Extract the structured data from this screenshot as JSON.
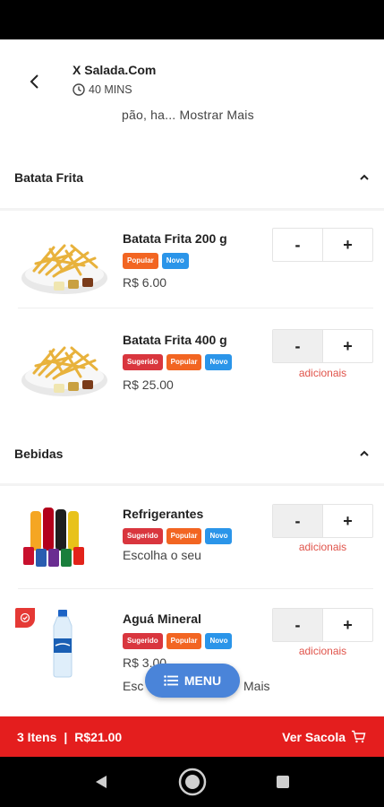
{
  "header": {
    "store_name": "X Salada.Com",
    "eta": "40 MINS",
    "description_tail": "pão,   ha... Mostrar Mais"
  },
  "sections": [
    {
      "title": "Batata Frita",
      "products": [
        {
          "name": "Batata Frita 200 g",
          "tags": [
            "Popular",
            "Novo"
          ],
          "price": "R$ 6.00"
        },
        {
          "name": "Batata Frita 400 g",
          "tags": [
            "Sugerido",
            "Popular",
            "Novo"
          ],
          "price": "R$ 25.00",
          "addons": "adicionais"
        }
      ]
    },
    {
      "title": "Bebidas",
      "products": [
        {
          "name": "Refrigerantes",
          "tags": [
            "Sugerido",
            "Popular",
            "Novo"
          ],
          "subtitle": "Escolha o seu",
          "addons": "adicionais"
        },
        {
          "name": "Aguá Mineral",
          "tags": [
            "Sugerido",
            "Popular",
            "Novo"
          ],
          "price": "R$ 3.00",
          "subtitle_left": "Esc",
          "subtitle_right": "Mais",
          "addons": "adicionais"
        }
      ]
    }
  ],
  "stepper": {
    "minus": "-",
    "plus": "+"
  },
  "menu_button": {
    "label": "MENU"
  },
  "cart": {
    "count": "3 Itens",
    "separator": "|",
    "total": "R$21.00",
    "action": "Ver Sacola"
  },
  "icons": {
    "back": "arrow-left-icon",
    "clock": "clock-icon",
    "collapse": "chevron-up-icon",
    "menu": "list-icon",
    "cart": "cart-icon"
  },
  "colors": {
    "cart_bar": "#e41e1e",
    "menu_fab": "#4a84d9",
    "tag_sugerido": "#d9363e",
    "tag_popular": "#f26522",
    "tag_novo": "#2b95e9",
    "addons_text": "#e0534a"
  }
}
